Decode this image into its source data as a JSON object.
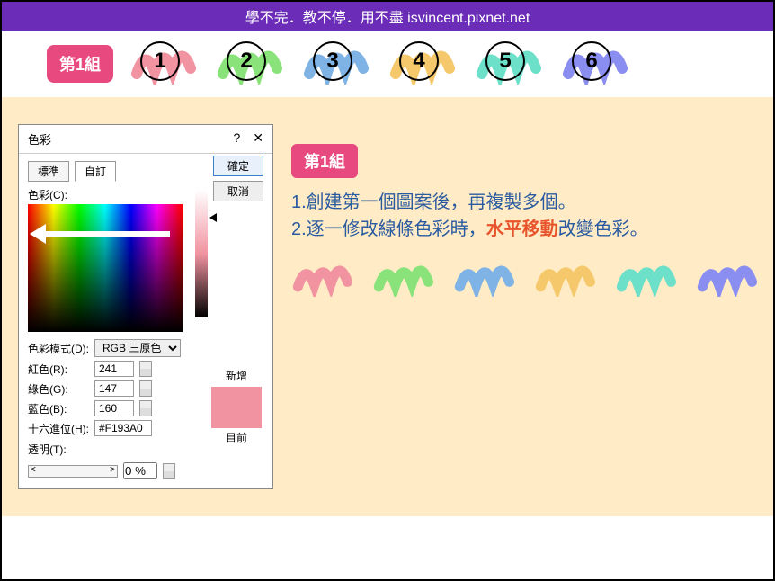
{
  "header": "學不完．教不停．用不盡 isvincent.pixnet.net",
  "groupBadge": "第1組",
  "circles": [
    {
      "num": "1",
      "color": "#f193a0"
    },
    {
      "num": "2",
      "color": "#8ae27a"
    },
    {
      "num": "3",
      "color": "#7fb3e6"
    },
    {
      "num": "4",
      "color": "#f5c96b"
    },
    {
      "num": "5",
      "color": "#6de0c9"
    },
    {
      "num": "6",
      "color": "#8a8ef0"
    }
  ],
  "dialog": {
    "title": "色彩",
    "help": "?",
    "close": "✕",
    "tabStandard": "標準",
    "tabCustom": "自訂",
    "ok": "確定",
    "cancel": "取消",
    "colorLabel": "色彩(C):",
    "modeLabel": "色彩模式(D):",
    "modeValue": "RGB 三原色",
    "rLabel": "紅色(R):",
    "rValue": "241",
    "gLabel": "綠色(G):",
    "gValue": "147",
    "bLabel": "藍色(B):",
    "bValue": "160",
    "hexLabel": "十六進位(H):",
    "hexValue": "#F193A0",
    "newLabel": "新增",
    "currentLabel": "目前",
    "transLabel": "透明(T):",
    "transValue": "0 %"
  },
  "explain": {
    "badge": "第1組",
    "line1_a": "1.創建第一個圖案後，再複製多個。",
    "line2_a": "2.逐一修改線條色彩時，",
    "line2_h": "水平移動",
    "line2_b": "改變色彩。"
  },
  "swatches": [
    "#f193a0",
    "#8ae27a",
    "#7fb3e6",
    "#f5c96b",
    "#6de0c9",
    "#8a8ef0"
  ]
}
